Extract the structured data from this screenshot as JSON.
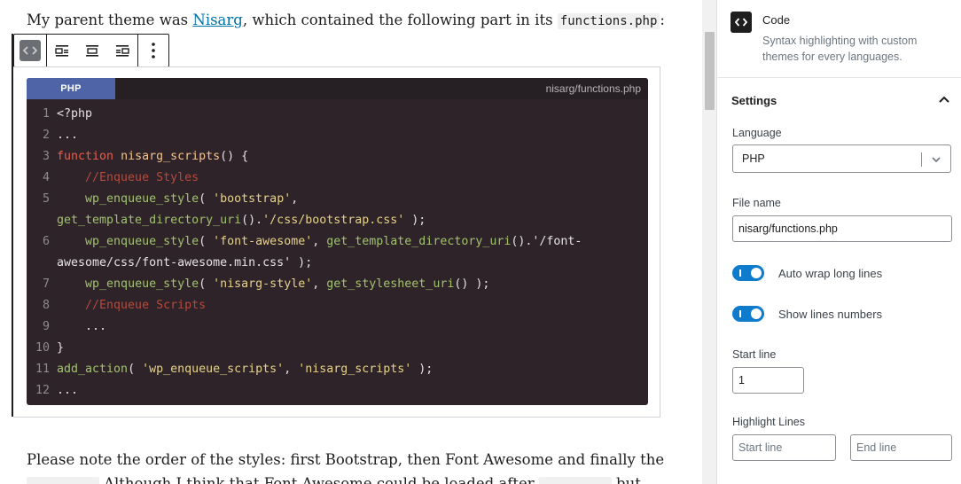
{
  "editor": {
    "para_top": {
      "before": "My parent theme was ",
      "link": "Nisarg",
      "middle": ", which contained the following part in its ",
      "code": "functions.php",
      "after": ":"
    },
    "para_bottom": "Please note the order of the styles: first Bootstrap, then Font Awesome and finally the",
    "para_cut_text": "Although I think that Font Awesome could be loaded after",
    "para_cut_tail": "but",
    "toolbar": {
      "block_icon": "code-block-icon",
      "align_left": "align-left-icon",
      "align_center": "align-center-icon",
      "align_right": "align-right-icon",
      "more": "more-options-icon"
    },
    "code_block": {
      "language": "PHP",
      "filename": "nisarg/functions.php",
      "lines": [
        {
          "n": "1",
          "text": "<?php"
        },
        {
          "n": "2",
          "text": "..."
        },
        {
          "n": "3",
          "text": "function nisarg_scripts() {"
        },
        {
          "n": "4",
          "text": "    //Enqueue Styles"
        },
        {
          "n": "5",
          "text": "    wp_enqueue_style( 'bootstrap',"
        },
        {
          "n": "",
          "text": "get_template_directory_uri().'/css/bootstrap.css' );"
        },
        {
          "n": "6",
          "text": "    wp_enqueue_style( 'font-awesome', get_template_directory_uri().'/font-"
        },
        {
          "n": "",
          "text": "awesome/css/font-awesome.min.css' );"
        },
        {
          "n": "7",
          "text": "    wp_enqueue_style( 'nisarg-style', get_stylesheet_uri() );"
        },
        {
          "n": "8",
          "text": "    //Enqueue Scripts"
        },
        {
          "n": "9",
          "text": "    ..."
        },
        {
          "n": "10",
          "text": "}"
        },
        {
          "n": "11",
          "text": "add_action( 'wp_enqueue_scripts', 'nisarg_scripts' );"
        },
        {
          "n": "12",
          "text": "..."
        }
      ]
    }
  },
  "sidebar": {
    "block_card": {
      "icon": "code-icon",
      "title": "Code",
      "description": "Syntax highlighting with custom themes for every languages."
    },
    "settings": {
      "title": "Settings",
      "toggle_icon": "chevron-up-icon",
      "language_label": "Language",
      "language_value": "PHP",
      "filename_label": "File name",
      "filename_value": "nisarg/functions.php",
      "auto_wrap_label": "Auto wrap long lines",
      "auto_wrap_on": true,
      "line_numbers_label": "Show lines numbers",
      "line_numbers_on": true,
      "start_line_label": "Start line",
      "start_line_value": "1",
      "highlight_label": "Highlight Lines",
      "highlight_start_placeholder": "Start line",
      "highlight_end_placeholder": "End line"
    }
  },
  "colors": {
    "accent": "#0e7bcc",
    "code_bg": "#2d2329",
    "lang_tag": "#4f64a6",
    "keyword": "#ea5e4c",
    "string": "#e8d28b",
    "builtin": "#a2c26e",
    "comment": "#b54a3d"
  }
}
